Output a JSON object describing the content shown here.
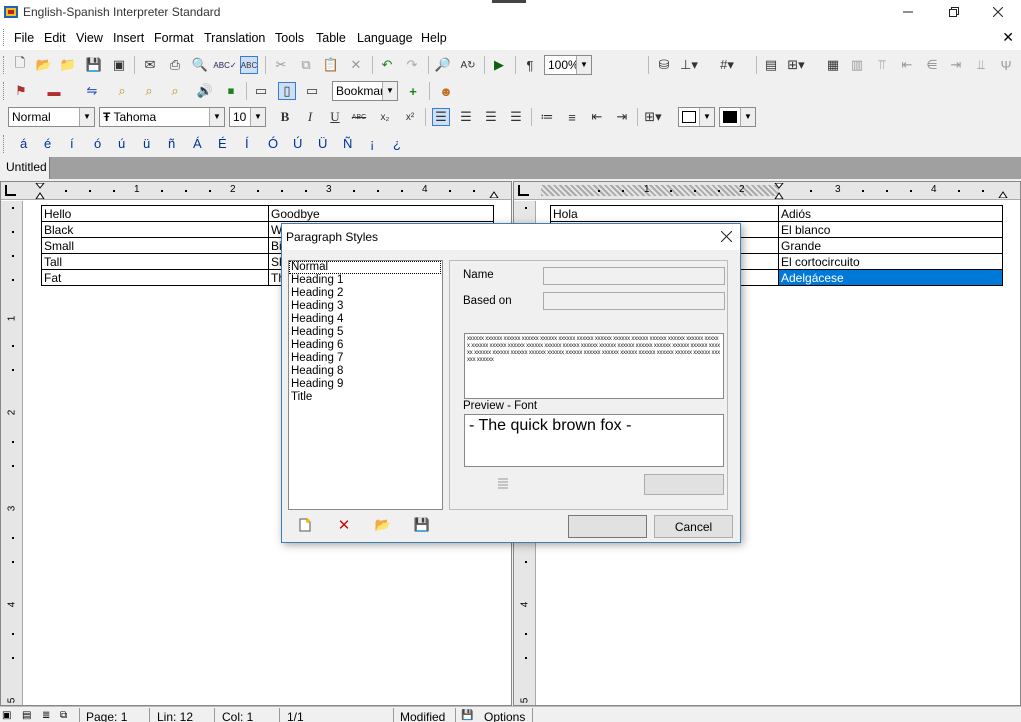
{
  "window": {
    "title": "English-Spanish Interpreter Standard"
  },
  "menu": [
    "File",
    "Edit",
    "View",
    "Insert",
    "Format",
    "Translation",
    "Tools",
    "Table",
    "Language",
    "Help"
  ],
  "toolbar": {
    "zoom": "100%",
    "bookmark": "Bookmark",
    "style": "Normal",
    "font": "Tahoma",
    "font_size": "10",
    "bold": "B",
    "italic": "I",
    "underline": "U",
    "strike": "ABC",
    "subscript": "x₂",
    "superscript": "x²",
    "pilcrow": "¶"
  },
  "special_chars": [
    "á",
    "é",
    "í",
    "ó",
    "ú",
    "ü",
    "ñ",
    "Á",
    "É",
    "Í",
    "Ó",
    "Ú",
    "Ü",
    "Ñ",
    "¡",
    "¿"
  ],
  "tabs": [
    "Untitled"
  ],
  "ruler": {
    "numbers": [
      "1",
      "2",
      "3",
      "4"
    ],
    "vertical": [
      "1",
      "2",
      "3",
      "4",
      "5"
    ]
  },
  "left_table": [
    [
      "Hello",
      "Goodbye"
    ],
    [
      "Black",
      "W"
    ],
    [
      "Small",
      "Bi"
    ],
    [
      "Tall",
      "Sh"
    ],
    [
      "Fat",
      "Th"
    ]
  ],
  "right_table": [
    [
      "Hola",
      "Adiós"
    ],
    [
      "",
      "El blanco"
    ],
    [
      "",
      "Grande"
    ],
    [
      "",
      "El cortocircuito"
    ],
    [
      "",
      "Adelgácese"
    ]
  ],
  "status": {
    "page": "Page: 1",
    "line": "Lin: 12",
    "col": "Col: 1",
    "pages": "1/1",
    "modified": "Modified",
    "options": "Options"
  },
  "dialog": {
    "title": "Paragraph Styles",
    "styles": [
      "Normal",
      "Heading 1",
      "Heading 2",
      "Heading 3",
      "Heading 4",
      "Heading 5",
      "Heading 6",
      "Heading 7",
      "Heading 8",
      "Heading 9",
      "Title"
    ],
    "name_label": "Name",
    "based_on_label": "Based on",
    "sample_text": "xxxxxx xxxxxx xxxxxx xxxxxx xxxxxx xxxxxx xxxxxx xxxxxx xxxxxx xxxxxx xxxxxx xxxxxx xxxxxx xxxxxx xxxxxx xxxxxx xxxxxx xxxxxx xxxxxx xxxxxx xxxxxx xxxxxx xxxxxx xxxxxx xxxxxx xxxxxx xxxxxx xxxxxx xxxxxx xxxxxx xxxxxx xxxxxx xxxxxx xxxxxx xxxxxx xxxxxx xxxxxx xxxxxx xxxxxx xxxxxx xxxxxx xxxxxx xxxxxx",
    "preview_label": "Preview - Font",
    "preview_text": "- The quick brown fox -",
    "cancel": "Cancel"
  }
}
